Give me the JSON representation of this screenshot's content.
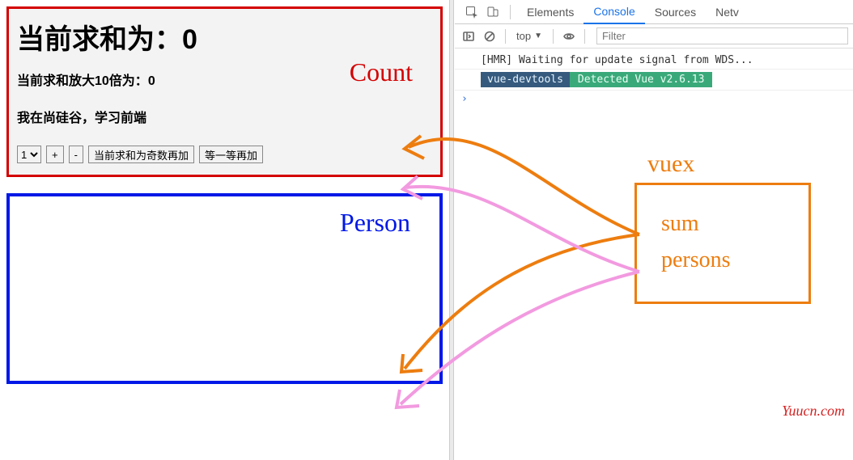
{
  "count": {
    "title_prefix": "当前求和为：",
    "title_value": "0",
    "subtitle_prefix": "当前求和放大10倍为：",
    "subtitle_value": "0",
    "info_text": "我在尚硅谷，学习前端",
    "label": "Count",
    "select_value": "1",
    "btn_plus": "+",
    "btn_minus": "-",
    "btn_odd": "当前求和为奇数再加",
    "btn_wait": "等一等再加"
  },
  "person": {
    "label": "Person"
  },
  "devtools": {
    "tabs": {
      "elements": "Elements",
      "console": "Console",
      "sources": "Sources",
      "network": "Netv"
    },
    "toolbar": {
      "context": "top",
      "filter_placeholder": "Filter"
    },
    "log_hmr": "[HMR] Waiting for update signal from WDS...",
    "badge_tool": "vue-devtools",
    "badge_detected": "Detected Vue v2.6.13",
    "prompt": "›"
  },
  "vuex": {
    "label": "vuex",
    "item_sum": "sum",
    "item_persons": "persons"
  },
  "watermark": "Yuucn.com"
}
